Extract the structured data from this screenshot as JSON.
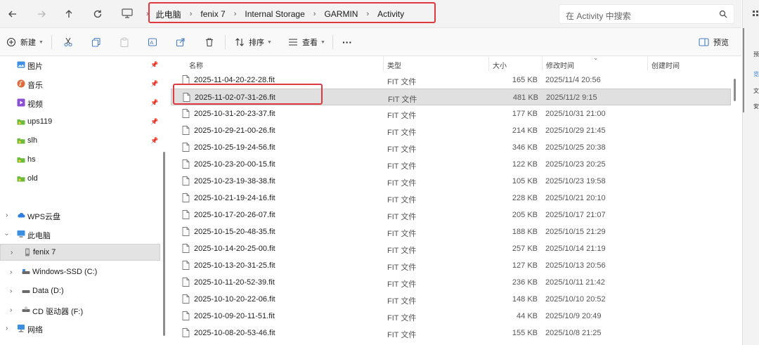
{
  "nav": {
    "back_icon": "arrow-left-icon",
    "forward_icon": "arrow-right-icon",
    "up_icon": "arrow-up-icon",
    "refresh_icon": "refresh-icon"
  },
  "breadcrumb": [
    "此电脑",
    "fenix 7",
    "Internal Storage",
    "GARMIN",
    "Activity"
  ],
  "search": {
    "placeholder": "在 Activity 中搜索"
  },
  "toolbar": {
    "new_label": "新建",
    "sort_label": "排序",
    "view_label": "查看",
    "more_label": "···",
    "preview_label": "预览"
  },
  "sidebar": {
    "quick_access": [
      {
        "label": "图片",
        "icon": "pictures-icon"
      },
      {
        "label": "音乐",
        "icon": "music-icon"
      },
      {
        "label": "视频",
        "icon": "video-icon"
      },
      {
        "label": "ups119",
        "icon": "folder-icon"
      },
      {
        "label": "slh",
        "icon": "folder-icon"
      },
      {
        "label": "hs",
        "icon": "folder-icon"
      },
      {
        "label": "old",
        "icon": "folder-icon"
      }
    ],
    "tree": [
      {
        "label": "WPS云盘",
        "icon": "cloud-icon"
      },
      {
        "label": "此电脑",
        "icon": "computer-icon"
      },
      {
        "label": "fenix 7",
        "icon": "device-icon"
      },
      {
        "label": "Windows-SSD (C:)",
        "icon": "drive-icon"
      },
      {
        "label": "Data (D:)",
        "icon": "drive-icon"
      },
      {
        "label": "CD 驱动器 (F:)",
        "icon": "cd-drive-icon"
      },
      {
        "label": "网络",
        "icon": "network-icon"
      }
    ]
  },
  "columns": [
    "名称",
    "类型",
    "大小",
    "修改时间",
    "创建时间"
  ],
  "files": [
    {
      "name": "2025-11-04-20-22-28.fit",
      "type": "FIT 文件",
      "size": "165 KB",
      "modified": "2025/11/4 20:56"
    },
    {
      "name": "2025-11-02-07-31-26.fit",
      "type": "FIT 文件",
      "size": "481 KB",
      "modified": "2025/11/2 9:15"
    },
    {
      "name": "2025-10-31-20-23-37.fit",
      "type": "FIT 文件",
      "size": "177 KB",
      "modified": "2025/10/31 21:00"
    },
    {
      "name": "2025-10-29-21-00-26.fit",
      "type": "FIT 文件",
      "size": "214 KB",
      "modified": "2025/10/29 21:45"
    },
    {
      "name": "2025-10-25-19-24-56.fit",
      "type": "FIT 文件",
      "size": "346 KB",
      "modified": "2025/10/25 20:38"
    },
    {
      "name": "2025-10-23-20-00-15.fit",
      "type": "FIT 文件",
      "size": "122 KB",
      "modified": "2025/10/23 20:25"
    },
    {
      "name": "2025-10-23-19-38-38.fit",
      "type": "FIT 文件",
      "size": "105 KB",
      "modified": "2025/10/23 19:58"
    },
    {
      "name": "2025-10-21-19-24-16.fit",
      "type": "FIT 文件",
      "size": "228 KB",
      "modified": "2025/10/21 20:10"
    },
    {
      "name": "2025-10-17-20-26-07.fit",
      "type": "FIT 文件",
      "size": "205 KB",
      "modified": "2025/10/17 21:07"
    },
    {
      "name": "2025-10-15-20-48-35.fit",
      "type": "FIT 文件",
      "size": "188 KB",
      "modified": "2025/10/15 21:29"
    },
    {
      "name": "2025-10-14-20-25-00.fit",
      "type": "FIT 文件",
      "size": "257 KB",
      "modified": "2025/10/14 21:19"
    },
    {
      "name": "2025-10-13-20-31-25.fit",
      "type": "FIT 文件",
      "size": "127 KB",
      "modified": "2025/10/13 20:56"
    },
    {
      "name": "2025-10-11-20-52-39.fit",
      "type": "FIT 文件",
      "size": "236 KB",
      "modified": "2025/10/11 21:42"
    },
    {
      "name": "2025-10-10-20-22-06.fit",
      "type": "FIT 文件",
      "size": "148 KB",
      "modified": "2025/10/10 20:52"
    },
    {
      "name": "2025-10-09-20-11-51.fit",
      "type": "FIT 文件",
      "size": "44 KB",
      "modified": "2025/10/9 20:49"
    },
    {
      "name": "2025-10-08-20-53-46.fit",
      "type": "FIT 文件",
      "size": "155 KB",
      "modified": "2025/10/8 21:25"
    }
  ],
  "selected_file_index": 1,
  "colors": {
    "highlight": "#e0393f",
    "selection": "#e0e0e0",
    "folder": "#6dbb3a"
  },
  "right_panel": {
    "labels": [
      "预",
      "览",
      "文",
      "安"
    ]
  }
}
